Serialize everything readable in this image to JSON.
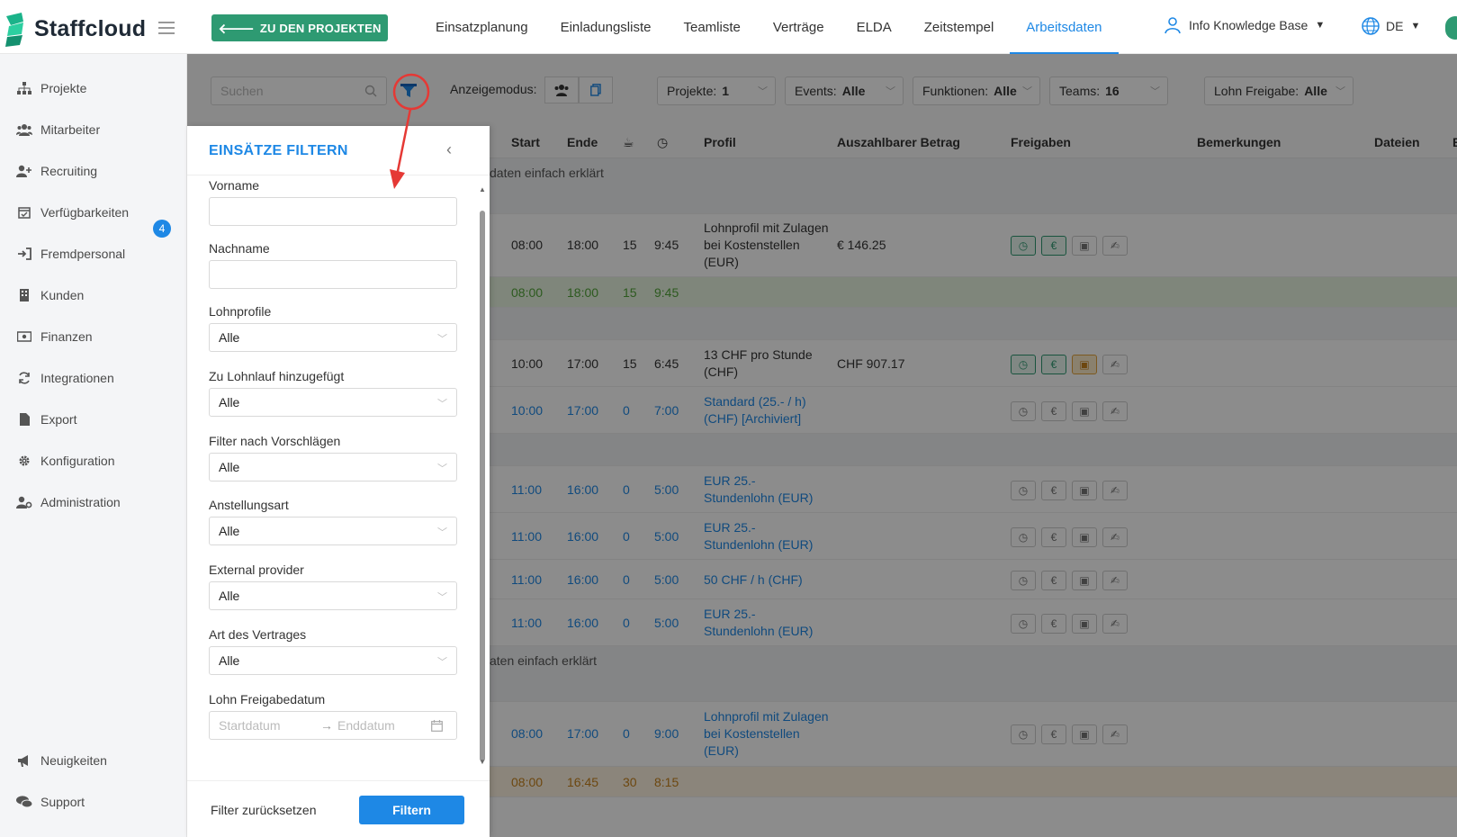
{
  "brand": {
    "name": "Staffcloud"
  },
  "header": {
    "back_button": "ZU DEN PROJEKTEN",
    "nav": [
      "Einsatzplanung",
      "Einladungsliste",
      "Teamliste",
      "Verträge",
      "ELDA",
      "Zeitstempel",
      "Arbeitsdaten"
    ],
    "active_nav": "Arbeitsdaten",
    "user": "Info Knowledge Base",
    "language": "DE"
  },
  "sidebar": {
    "items": [
      {
        "label": "Projekte",
        "icon": "sitemap-icon"
      },
      {
        "label": "Mitarbeiter",
        "icon": "users-icon"
      },
      {
        "label": "Recruiting",
        "icon": "user-plus-icon",
        "badge": "4"
      },
      {
        "label": "Verfügbarkeiten",
        "icon": "calendar-check-icon"
      },
      {
        "label": "Fremdpersonal",
        "icon": "sign-in-icon"
      },
      {
        "label": "Kunden",
        "icon": "building-icon"
      },
      {
        "label": "Finanzen",
        "icon": "money-icon"
      },
      {
        "label": "Integrationen",
        "icon": "sync-icon"
      },
      {
        "label": "Export",
        "icon": "file-icon"
      },
      {
        "label": "Konfiguration",
        "icon": "gear-icon"
      },
      {
        "label": "Administration",
        "icon": "user-cog-icon"
      }
    ],
    "bottom": [
      {
        "label": "Neuigkeiten",
        "icon": "megaphone-icon"
      },
      {
        "label": "Support",
        "icon": "chat-icon"
      }
    ]
  },
  "toolbar": {
    "search_placeholder": "Suchen",
    "display_mode_label": "Anzeigemodus:",
    "filters": [
      {
        "label": "Projekte:",
        "value": "1"
      },
      {
        "label": "Events:",
        "value": "Alle"
      },
      {
        "label": "Funktionen:",
        "value": "Alle"
      },
      {
        "label": "Teams:",
        "value": "16"
      },
      {
        "label": "Lohn Freigabe:",
        "value": "Alle"
      }
    ]
  },
  "table": {
    "columns": [
      "Start",
      "Ende",
      "Profil",
      "Auszahlbarer Betrag",
      "Freigaben",
      "Bemerkungen",
      "Dateien",
      "E"
    ],
    "group_label_1": "daten einfach erklärt",
    "group_label_2": "aten einfach erklärt",
    "rows": [
      {
        "start": "08:00",
        "end": "18:00",
        "pause": "15",
        "dur": "9:45",
        "profile": "Lohnprofil mit Zulagen bei Kostenstellen (EUR)",
        "amount": "€ 146.25"
      },
      {
        "start": "08:00",
        "end": "18:00",
        "pause": "15",
        "dur": "9:45"
      },
      {
        "start": "10:00",
        "end": "17:00",
        "pause": "15",
        "dur": "6:45",
        "profile": "13 CHF pro Stunde (CHF)",
        "amount": "CHF 907.17"
      },
      {
        "start": "10:00",
        "end": "17:00",
        "pause": "0",
        "dur": "7:00",
        "profile": "Standard (25.- / h) (CHF) [Archiviert]"
      },
      {
        "start": "11:00",
        "end": "16:00",
        "pause": "0",
        "dur": "5:00",
        "profile": "EUR 25.- Stundenlohn (EUR)"
      },
      {
        "start": "11:00",
        "end": "16:00",
        "pause": "0",
        "dur": "5:00",
        "profile": "EUR 25.- Stundenlohn (EUR)"
      },
      {
        "start": "11:00",
        "end": "16:00",
        "pause": "0",
        "dur": "5:00",
        "profile": "50 CHF / h (CHF)"
      },
      {
        "start": "11:00",
        "end": "16:00",
        "pause": "0",
        "dur": "5:00",
        "profile": "EUR 25.- Stundenlohn (EUR)"
      },
      {
        "start": "08:00",
        "end": "17:00",
        "pause": "0",
        "dur": "9:00",
        "profile": "Lohnprofil mit Zulagen bei Kostenstellen (EUR)"
      },
      {
        "start": "08:00",
        "end": "16:45",
        "pause": "30",
        "dur": "8:15"
      }
    ]
  },
  "filter_panel": {
    "title": "EINSÄTZE FILTERN",
    "fields": {
      "first_name": "Vorname",
      "last_name": "Nachname",
      "wage_profiles": {
        "label": "Lohnprofile",
        "value": "Alle"
      },
      "added_to_payroll": {
        "label": "Zu Lohnlauf hinzugefügt",
        "value": "Alle"
      },
      "suggestions": {
        "label": "Filter nach Vorschlägen",
        "value": "Alle"
      },
      "employment_type": {
        "label": "Anstellungsart",
        "value": "Alle"
      },
      "external_provider": {
        "label": "External provider",
        "value": "Alle"
      },
      "contract_type": {
        "label": "Art des Vertrages",
        "value": "Alle"
      },
      "wage_release_date": {
        "label": "Lohn Freigabedatum",
        "start_placeholder": "Startdatum",
        "end_placeholder": "Enddatum"
      }
    },
    "reset_label": "Filter zurücksetzen",
    "apply_label": "Filtern"
  },
  "colors": {
    "accent": "#1e88e5",
    "brand": "#2e9a72",
    "annotation": "#e53935"
  }
}
